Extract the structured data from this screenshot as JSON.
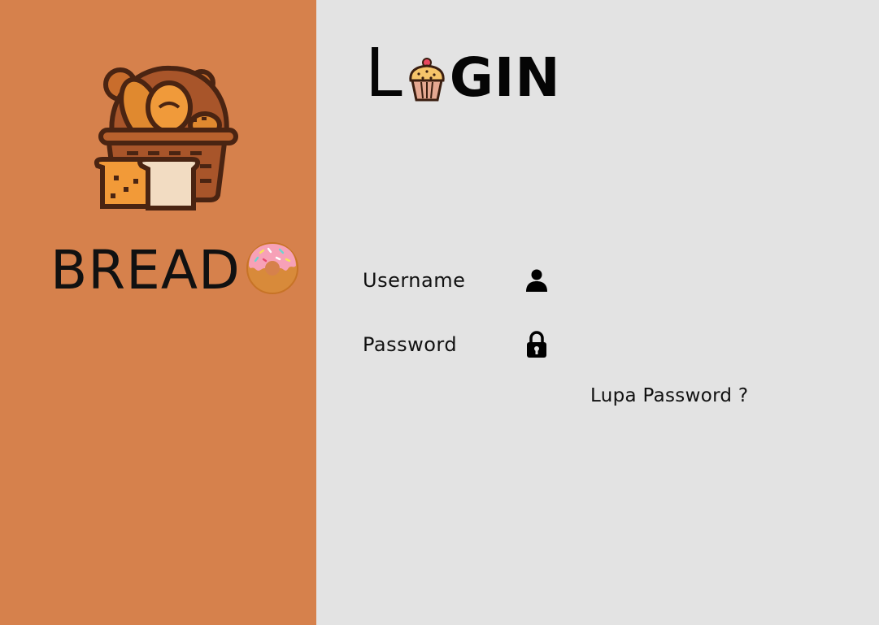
{
  "colors": {
    "left_panel": "#d6814c",
    "right_panel": "#e3e3e3"
  },
  "brand": {
    "name": "BREAD",
    "logo_icon": "bread-basket-icon",
    "emoji_icon": "donut-icon"
  },
  "login": {
    "title_start": "L",
    "title_icon": "cupcake-icon",
    "title_end": "GIN",
    "username_label": "Username",
    "username_icon": "user-icon",
    "password_label": "Password",
    "password_icon": "lock-icon",
    "forgot_password": "Lupa Password ?"
  }
}
